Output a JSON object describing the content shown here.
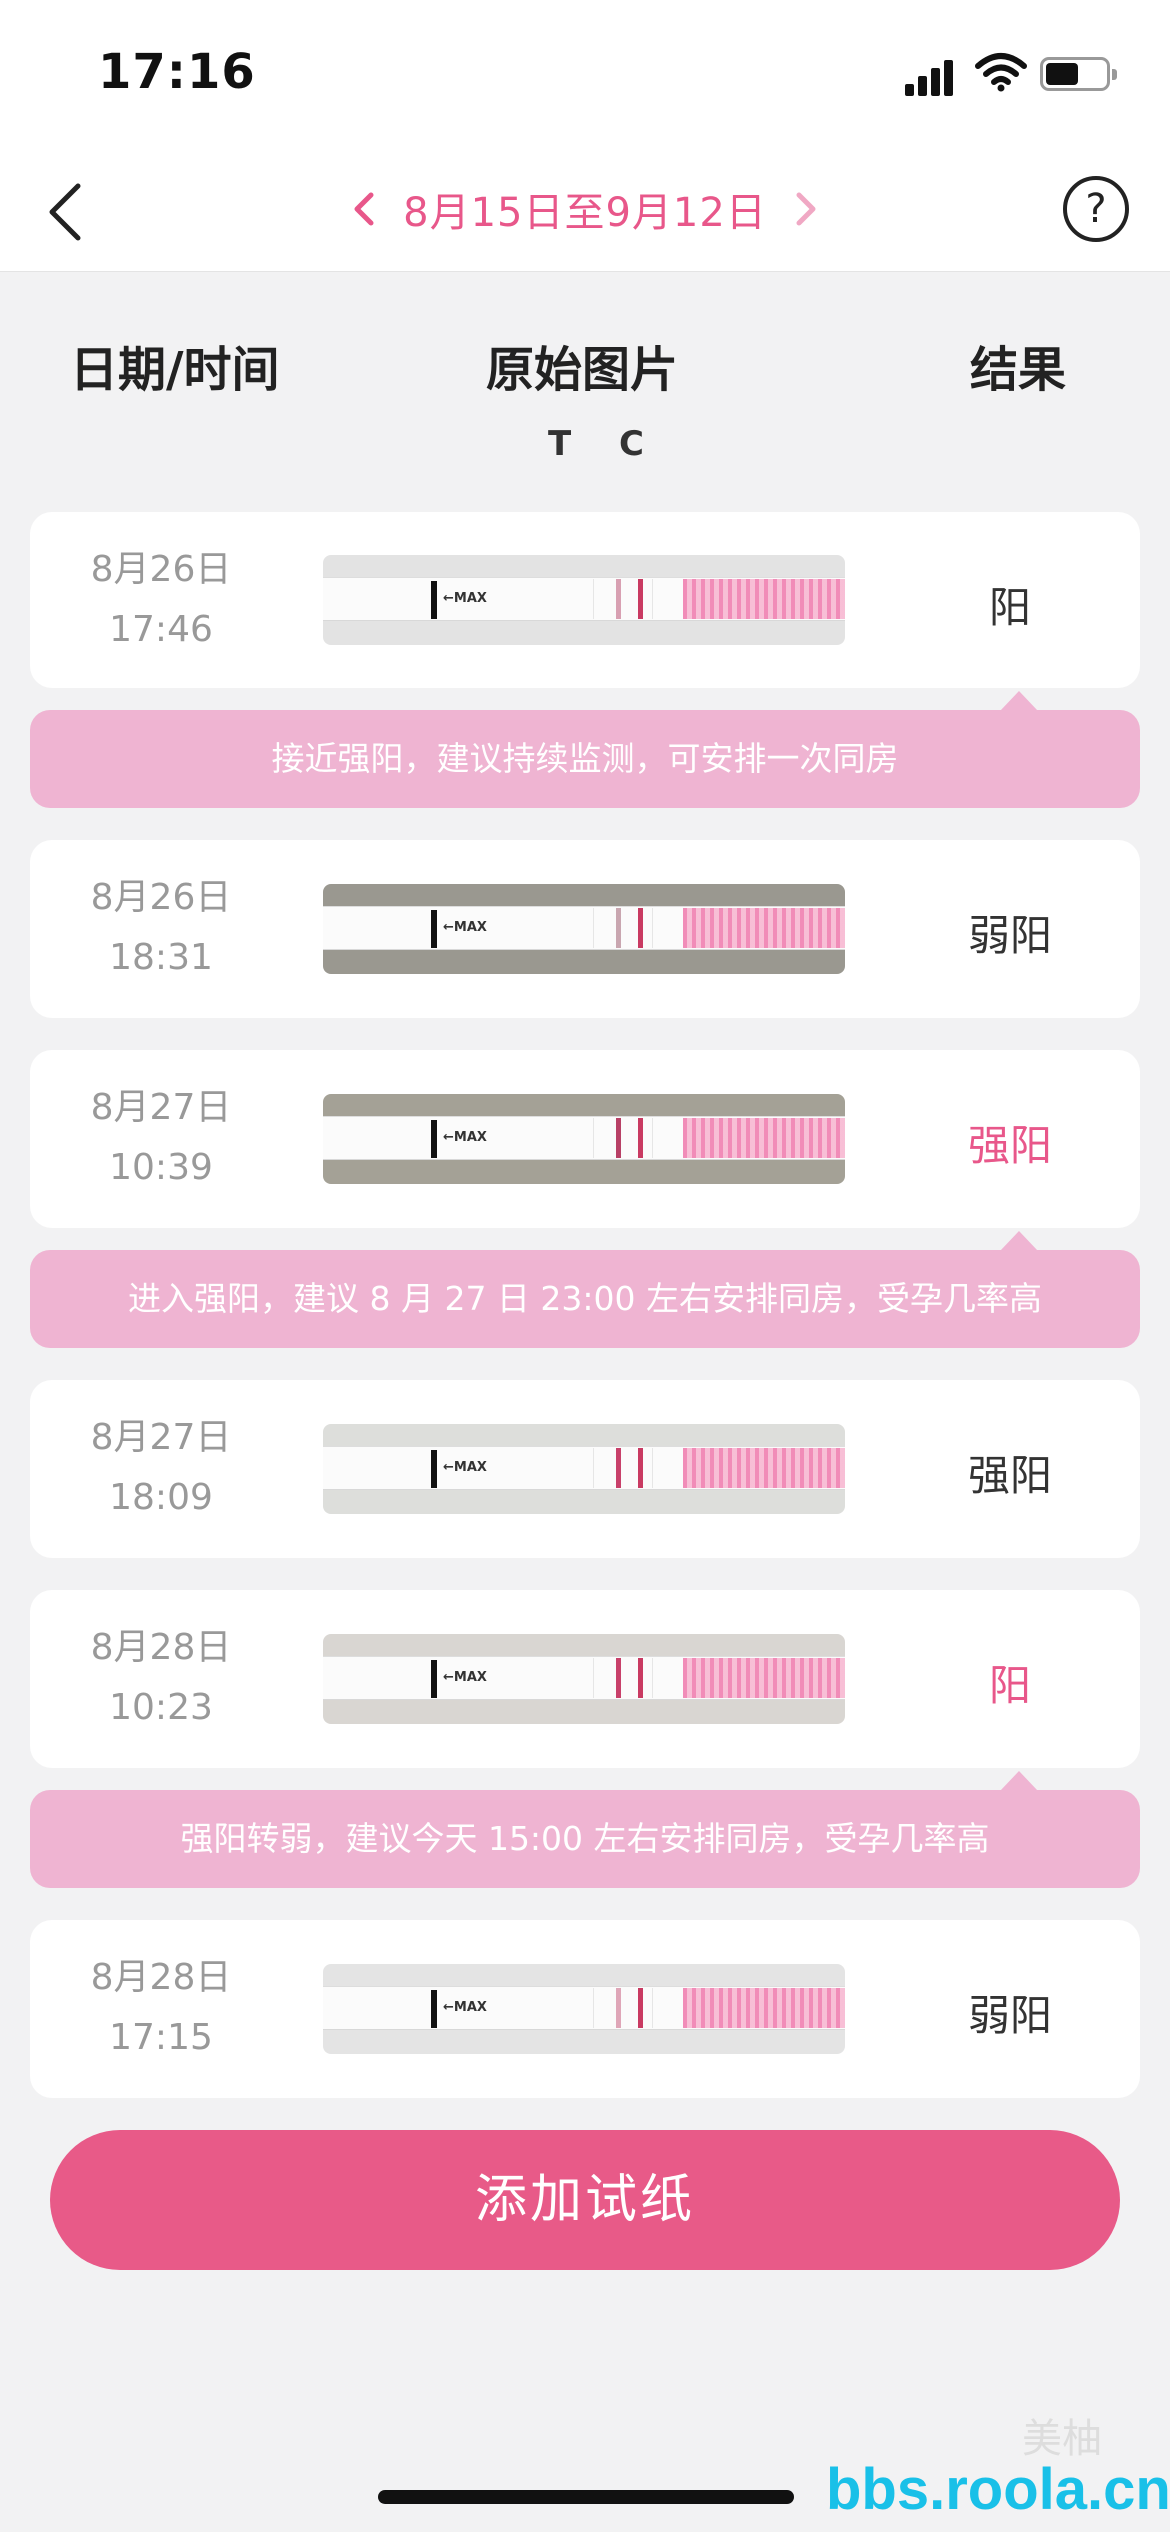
{
  "status": {
    "time": "17:16",
    "battery_level": 0.55
  },
  "nav": {
    "range": "8月15日至9月12日",
    "help": "?"
  },
  "columns": {
    "date": "日期/时间",
    "image": "原始图片",
    "result": "结果",
    "tc": "T C"
  },
  "records": [
    {
      "date": "8月26日",
      "time": "17:46",
      "result": "阳",
      "result_color": "#333333"
    },
    {
      "date": "8月26日",
      "time": "18:31",
      "result": "弱阳",
      "result_color": "#333333"
    },
    {
      "date": "8月27日",
      "time": "10:39",
      "result": "强阳",
      "result_color": "#e8578a"
    },
    {
      "date": "8月27日",
      "time": "18:09",
      "result": "强阳",
      "result_color": "#333333"
    },
    {
      "date": "8月28日",
      "time": "10:23",
      "result": "阳",
      "result_color": "#e8578a"
    },
    {
      "date": "8月28日",
      "time": "17:15",
      "result": "弱阳",
      "result_color": "#333333"
    }
  ],
  "tips": [
    "接近强阳，建议持续监测，可安排一次同房",
    "进入强阳，建议 8 月 27 日 23:00 左右安排同房，受孕几率高",
    "强阳转弱，建议今天 15:00 左右安排同房，受孕几率高"
  ],
  "strip": {
    "max_label": "←MAX"
  },
  "add_button": "添加试纸",
  "watermark": {
    "site": "bbs.roola.cn",
    "brand": "美柚"
  },
  "colors": {
    "accent": "#e8578a",
    "tip_bg": "#efb4d2",
    "button": "#e85a88"
  }
}
